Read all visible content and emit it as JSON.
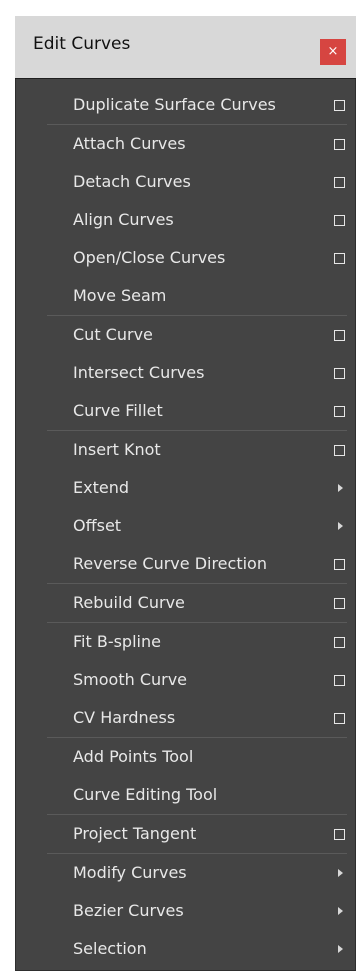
{
  "window": {
    "title": "Edit Curves",
    "close_label": "×"
  },
  "menu": {
    "groups": [
      [
        {
          "label": "Duplicate Surface Curves",
          "option_box": true,
          "submenu": false
        }
      ],
      [
        {
          "label": "Attach Curves",
          "option_box": true,
          "submenu": false
        },
        {
          "label": "Detach Curves",
          "option_box": true,
          "submenu": false
        },
        {
          "label": "Align Curves",
          "option_box": true,
          "submenu": false
        },
        {
          "label": "Open/Close Curves",
          "option_box": true,
          "submenu": false
        },
        {
          "label": "Move Seam",
          "option_box": false,
          "submenu": false
        }
      ],
      [
        {
          "label": "Cut Curve",
          "option_box": true,
          "submenu": false
        },
        {
          "label": "Intersect Curves",
          "option_box": true,
          "submenu": false
        },
        {
          "label": "Curve Fillet",
          "option_box": true,
          "submenu": false
        }
      ],
      [
        {
          "label": "Insert Knot",
          "option_box": true,
          "submenu": false
        },
        {
          "label": "Extend",
          "option_box": false,
          "submenu": true
        },
        {
          "label": "Offset",
          "option_box": false,
          "submenu": true
        },
        {
          "label": "Reverse Curve Direction",
          "option_box": true,
          "submenu": false
        }
      ],
      [
        {
          "label": "Rebuild Curve",
          "option_box": true,
          "submenu": false
        }
      ],
      [
        {
          "label": "Fit B-spline",
          "option_box": true,
          "submenu": false
        },
        {
          "label": "Smooth Curve",
          "option_box": true,
          "submenu": false
        },
        {
          "label": "CV Hardness",
          "option_box": true,
          "submenu": false
        }
      ],
      [
        {
          "label": "Add Points Tool",
          "option_box": false,
          "submenu": false
        },
        {
          "label": "Curve Editing Tool",
          "option_box": false,
          "submenu": false
        }
      ],
      [
        {
          "label": "Project Tangent",
          "option_box": true,
          "submenu": false
        }
      ],
      [
        {
          "label": "Modify Curves",
          "option_box": false,
          "submenu": true
        },
        {
          "label": "Bezier Curves",
          "option_box": false,
          "submenu": true
        },
        {
          "label": "Selection",
          "option_box": false,
          "submenu": true
        }
      ]
    ]
  },
  "colors": {
    "panel_bg": "#444444",
    "title_bg": "#d8d8d8",
    "close_bg": "#d64541",
    "text": "#e8e8e8",
    "separator": "#5a5a5a"
  }
}
